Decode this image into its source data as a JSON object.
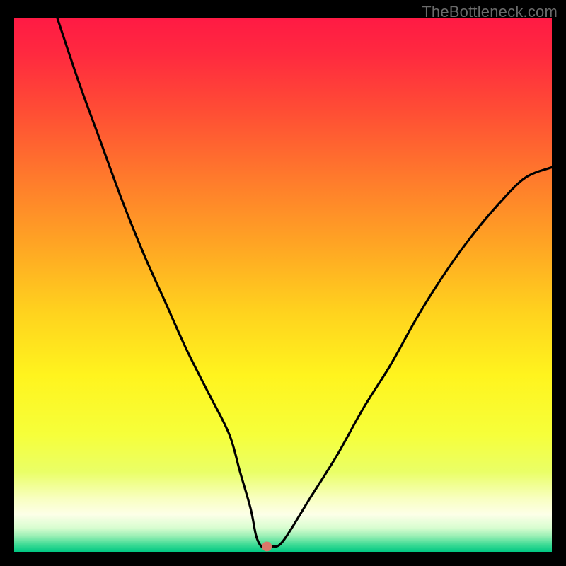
{
  "watermark": "TheBottleneck.com",
  "chart_data": {
    "type": "line",
    "title": "",
    "xlabel": "",
    "ylabel": "",
    "xlim": [
      0,
      100
    ],
    "ylim": [
      0,
      100
    ],
    "curve": {
      "name": "bottleneck-curve",
      "x": [
        8,
        12,
        16,
        20,
        24,
        28,
        32,
        36,
        40,
        42,
        44,
        45,
        46,
        47,
        48,
        50,
        55,
        60,
        65,
        70,
        75,
        80,
        85,
        90,
        95,
        100
      ],
      "y": [
        100,
        88,
        77,
        66,
        56,
        47,
        38,
        30,
        22,
        15,
        8,
        3,
        1,
        1,
        1,
        2,
        10,
        18,
        27,
        35,
        44,
        52,
        59,
        65,
        70,
        72
      ]
    },
    "marker": {
      "x": 47,
      "y": 1,
      "color": "#d9776a"
    },
    "background_gradient": {
      "stops": [
        {
          "offset": 0.0,
          "color": "#ff1a44"
        },
        {
          "offset": 0.07,
          "color": "#ff2a3f"
        },
        {
          "offset": 0.18,
          "color": "#ff4f34"
        },
        {
          "offset": 0.3,
          "color": "#ff7a2c"
        },
        {
          "offset": 0.42,
          "color": "#ffa324"
        },
        {
          "offset": 0.55,
          "color": "#ffd21e"
        },
        {
          "offset": 0.67,
          "color": "#fff41e"
        },
        {
          "offset": 0.78,
          "color": "#f6ff3a"
        },
        {
          "offset": 0.85,
          "color": "#eaff66"
        },
        {
          "offset": 0.9,
          "color": "#f8ffc0"
        },
        {
          "offset": 0.93,
          "color": "#fdffe8"
        },
        {
          "offset": 0.955,
          "color": "#d8fdd0"
        },
        {
          "offset": 0.97,
          "color": "#9df0b6"
        },
        {
          "offset": 0.985,
          "color": "#46dd98"
        },
        {
          "offset": 1.0,
          "color": "#00c782"
        }
      ]
    }
  }
}
